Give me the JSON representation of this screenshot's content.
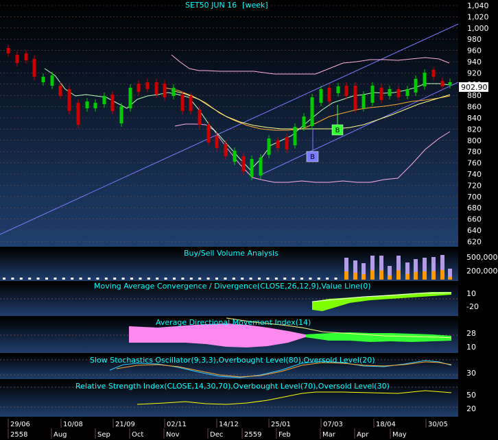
{
  "main_chart": {
    "title": "SET50 JUN 16",
    "interval": "[week]",
    "price_axis": [
      "1,040",
      "1,020",
      "1,000",
      "980",
      "960",
      "940",
      "920",
      "900",
      "880",
      "860",
      "840",
      "820",
      "800",
      "780",
      "760",
      "740",
      "720",
      "700",
      "680",
      "660",
      "640",
      "620"
    ],
    "last_price": "902.90",
    "signal_b_blue": "B",
    "signal_b_green": "B"
  },
  "volume_panel": {
    "title": "Buy/Sell Volume Analysis",
    "axis": [
      "500,000",
      "200,000"
    ]
  },
  "macd_panel": {
    "title": "Moving Average Convergence / Divergence(CLOSE,26,12,9),Value Line(0)",
    "axis": [
      "10",
      "-20"
    ]
  },
  "adx_panel": {
    "title": "Average Directional Movement Index(14)",
    "axis": [
      "28",
      "10"
    ]
  },
  "stoch_panel": {
    "title": "Slow Stochastics Oscillator(9,3,3),Overbought Level(80),Oversold Level(20)",
    "axis": [
      "30"
    ]
  },
  "rsi_panel": {
    "title": "Relative Strength Index(CLOSE,14,30,70),Overbought Level(70),Oversold Level(30)",
    "axis": [
      "50",
      "20"
    ]
  },
  "x_axis": {
    "dates": [
      "29/06",
      "10/08",
      "21/09",
      "02/11",
      "14/12",
      "25/01",
      "07/03",
      "18/04",
      "30/05"
    ],
    "months": [
      "2558",
      "Aug",
      "Sep",
      "Oct",
      "Nov",
      "Dec",
      "2559",
      "Feb",
      "Mar",
      "Apr",
      "May"
    ]
  },
  "colors": {
    "background": "#000000",
    "panel_bg": "#1f3f6e",
    "grid": "#6b4a4a",
    "axis_text": "#ffffff",
    "title_text": "#00ffff",
    "trendline": "#7b7bff",
    "bollinger": "#ffb0e0",
    "ma_short": "#bbffbb",
    "ma_mid": "#ffaa33",
    "ma_long": "#ffff88",
    "candle_up": "#00cc00",
    "candle_down": "#cc0000",
    "macd_hist": "#7fff00",
    "adx_pink": "#ff88ee",
    "adx_green": "#33ff33",
    "rsi_line": "#ffff00",
    "stoch_k": "#33ccff",
    "stoch_d": "#ffaa33"
  }
}
